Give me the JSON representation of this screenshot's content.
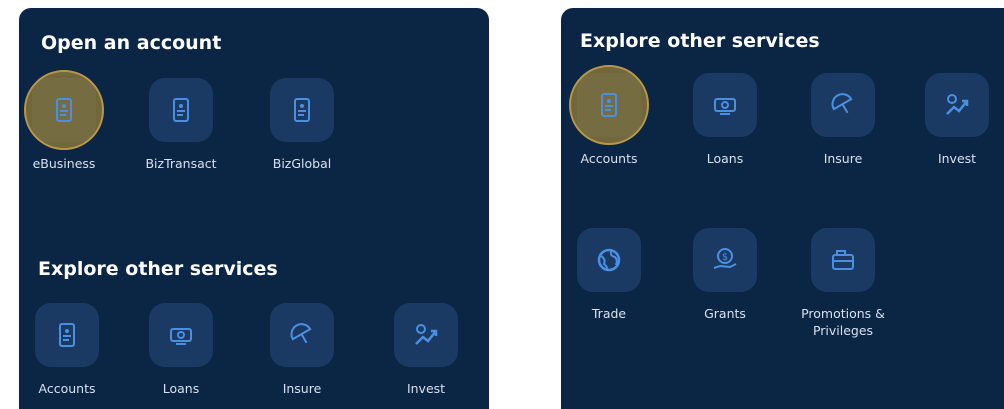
{
  "left_panel": {
    "open_account": {
      "title": "Open an account",
      "items": [
        {
          "label": "eBusiness",
          "icon": "document-icon"
        },
        {
          "label": "BizTransact",
          "icon": "document-icon"
        },
        {
          "label": "BizGlobal",
          "icon": "document-icon"
        }
      ]
    },
    "explore": {
      "title": "Explore other services",
      "items": [
        {
          "label": "Accounts",
          "icon": "document-icon"
        },
        {
          "label": "Loans",
          "icon": "banknote-icon"
        },
        {
          "label": "Insure",
          "icon": "umbrella-icon"
        },
        {
          "label": "Invest",
          "icon": "growth-chart-icon"
        }
      ]
    }
  },
  "right_panel": {
    "title": "Explore other services",
    "items": [
      {
        "label": "Accounts",
        "icon": "document-icon"
      },
      {
        "label": "Loans",
        "icon": "banknote-icon"
      },
      {
        "label": "Insure",
        "icon": "umbrella-icon"
      },
      {
        "label": "Invest",
        "icon": "growth-chart-icon"
      },
      {
        "label": "Trade",
        "icon": "globe-icon"
      },
      {
        "label": "Grants",
        "icon": "coin-hand-icon"
      },
      {
        "label": "Promotions & Privileges",
        "icon": "wallet-icon"
      }
    ]
  },
  "colors": {
    "panel_bg": "#0b2545",
    "tile_bg": "#1b3a63",
    "icon_accent": "#4a90e2",
    "highlight": "#a88a45",
    "title_text": "#ffffff",
    "label_text": "#d8e1ee"
  }
}
